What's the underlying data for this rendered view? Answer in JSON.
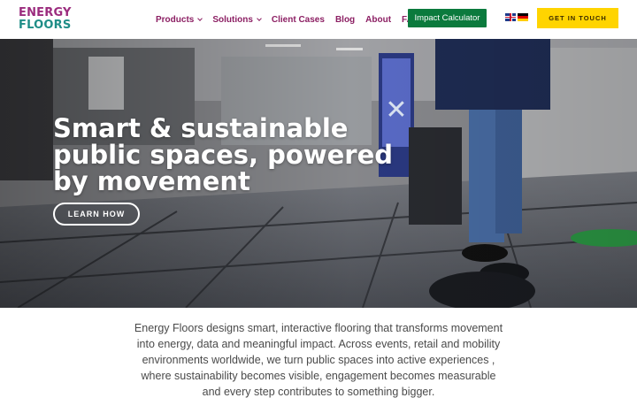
{
  "brand": {
    "logo_line1": "ENERGY",
    "logo_line2": "FLOORS",
    "color_primary": "#9b2c7e",
    "color_secondary": "#1f8d87"
  },
  "nav": {
    "items": [
      {
        "label": "Products",
        "has_dropdown": true
      },
      {
        "label": "Solutions",
        "has_dropdown": true
      },
      {
        "label": "Client Cases",
        "has_dropdown": false
      },
      {
        "label": "Blog",
        "has_dropdown": false
      },
      {
        "label": "About",
        "has_dropdown": false
      },
      {
        "label": "FAQ",
        "has_dropdown": false
      }
    ],
    "impact_button": "Impact Calculator",
    "impact_button_color": "#0b7a3d",
    "languages": [
      "english-flag-icon",
      "german-flag-icon"
    ],
    "cta_button": "GET IN TOUCH",
    "cta_button_color": "#ffd400"
  },
  "hero": {
    "title": "Smart & sustainable public spaces, powered by movement",
    "button": "LEARN HOW"
  },
  "intro": {
    "text": "Energy Floors designs smart, interactive flooring that transforms movement into energy, data and meaningful impact. Across events, retail and mobility environments worldwide, we turn public spaces into active experiences , where sustainability becomes visible, engagement becomes measurable and every step contributes to something bigger."
  }
}
